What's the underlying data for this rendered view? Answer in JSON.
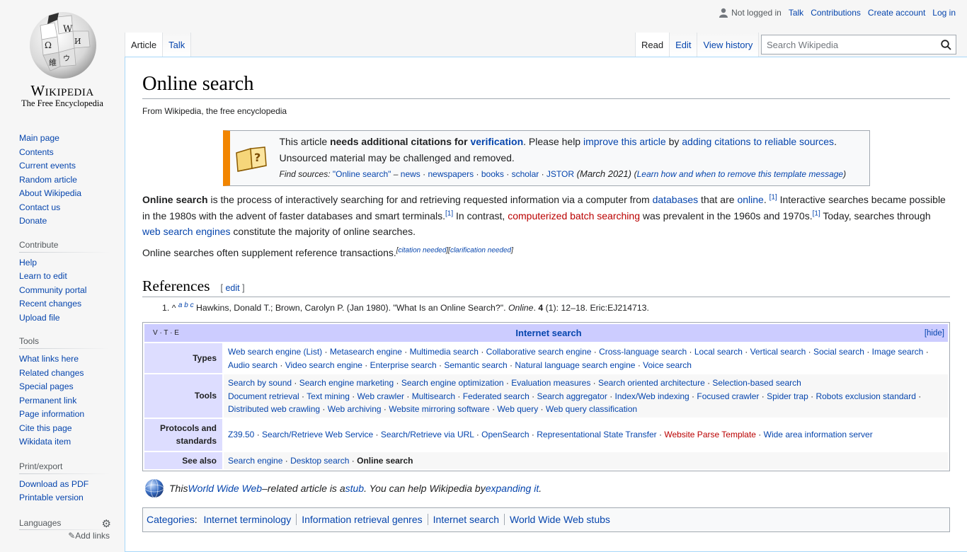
{
  "logo": {
    "wordmark": "Wikipedia",
    "tagline": "The Free Encyclopedia"
  },
  "personal": {
    "not_logged_in": "Not logged in",
    "talk": "Talk",
    "contributions": "Contributions",
    "create_account": "Create account",
    "login": "Log in"
  },
  "tabs": {
    "article": "Article",
    "talk": "Talk",
    "read": "Read",
    "edit": "Edit",
    "view_history": "View history"
  },
  "search": {
    "placeholder": "Search Wikipedia"
  },
  "sidebar": {
    "navigation": [
      "Main page",
      "Contents",
      "Current events",
      "Random article",
      "About Wikipedia",
      "Contact us",
      "Donate"
    ],
    "contribute_heading": "Contribute",
    "contribute": [
      "Help",
      "Learn to edit",
      "Community portal",
      "Recent changes",
      "Upload file"
    ],
    "tools_heading": "Tools",
    "tools": [
      "What links here",
      "Related changes",
      "Special pages",
      "Permanent link",
      "Page information",
      "Cite this page",
      "Wikidata item"
    ],
    "print_heading": "Print/export",
    "print": [
      "Download as PDF",
      "Printable version"
    ],
    "languages_heading": "Languages",
    "add_links": "Add links"
  },
  "article": {
    "title": "Online search",
    "tagline": "From Wikipedia, the free encyclopedia",
    "ambox": {
      "line1_pre": "This article ",
      "line1_bold": "needs additional citations for ",
      "line1_verification": "verification",
      "line1_mid": ". Please help ",
      "line1_improve": "improve this article",
      "line1_by": " by ",
      "line1_adding": "adding citations to reliable sources",
      "line1_end": ".",
      "line2": "Unsourced material may be challenged and removed.",
      "find_label": "Find sources: ",
      "find_q": "\"Online search\"",
      "find_dash": " – ",
      "sources": [
        "news",
        "newspapers",
        "books",
        "scholar",
        "JSTOR"
      ],
      "date": " (March 2021) ",
      "learn": "Learn how and when to remove this template message"
    },
    "p1": {
      "bold": "Online search",
      "t1": " is the process of interactively searching for and retrieving requested information via a computer from ",
      "databases": "databases",
      "t2": " that are ",
      "online": "online",
      "t3": ". ",
      "ref": "[1]",
      "t4": " Interactive searches became possible in the 1980s with the advent of faster databases and smart terminals.",
      "t5": " In contrast, ",
      "computerized": "computerized batch searching",
      "t6": " was prevalent in the 1960s and 1970s.",
      "t7": " Today, searches through ",
      "web_search_engines": "web search engines",
      "t8": " constitute the majority of online searches."
    },
    "p2": {
      "text": "Online searches often supplement reference transactions.",
      "citation_needed": "citation needed",
      "clarification_needed": "clarification needed"
    },
    "references_heading": "References",
    "edit_label": "edit",
    "ref1": {
      "num": "1.",
      "caret": "^",
      "letters": "a b c",
      "text_pre": " Hawkins, Donald T.; Brown, Carolyn P. (Jan 1980). \"What Is an Online Search?\". ",
      "journal": "Online",
      "vol": "4",
      "text_post": " (1): 12–18. Eric:EJ214713."
    }
  },
  "navbox": {
    "vte": "V · T · E",
    "title": "Internet search",
    "hide": "[hide]",
    "groups": [
      {
        "name": "Types",
        "items": [
          "Web search engine (List)",
          "Metasearch engine",
          "Multimedia search",
          "Collaborative search engine",
          "Cross-language search",
          "Local search",
          "Vertical search",
          "Social search",
          "Image search",
          "Audio search",
          "Video search engine",
          "Enterprise search",
          "Semantic search",
          "Natural language search engine",
          "Voice search"
        ]
      },
      {
        "name": "Tools",
        "items": [
          "Search by sound",
          "Search engine marketing",
          "Search engine optimization",
          "Evaluation measures",
          "Search oriented architecture",
          "Selection-based search",
          "Document retrieval",
          "Text mining",
          "Web crawler",
          "Multisearch",
          "Federated search",
          "Search aggregator",
          "Index/Web indexing",
          "Focused crawler",
          "Spider trap",
          "Robots exclusion standard",
          "Distributed web crawling",
          "Web archiving",
          "Website mirroring software",
          "Web query",
          "Web query classification"
        ]
      },
      {
        "name": "Protocols and standards",
        "items": [
          "Z39.50",
          "Search/Retrieve Web Service",
          "Search/Retrieve via URL",
          "OpenSearch",
          "Representational State Transfer",
          "Website Parse Template",
          "Wide area information server"
        ]
      },
      {
        "name": "See also",
        "items": [
          "Search engine",
          "Desktop search",
          "Online search"
        ]
      }
    ]
  },
  "stub": {
    "t1": "This ",
    "www": "World Wide Web",
    "t2": "–related article is a ",
    "stub": "stub",
    "t3": ". You can help Wikipedia by ",
    "expanding": "expanding it",
    "t4": "."
  },
  "categories": {
    "label": "Categories",
    "items": [
      "Internet terminology",
      "Information retrieval genres",
      "Internet search",
      "World Wide Web stubs"
    ]
  },
  "colors": {
    "link": "#0645ad",
    "redlink": "#ba0000",
    "ambox_border": "#f28500",
    "navbox_title": "#ccccff",
    "navbox_group": "#ddddff"
  }
}
